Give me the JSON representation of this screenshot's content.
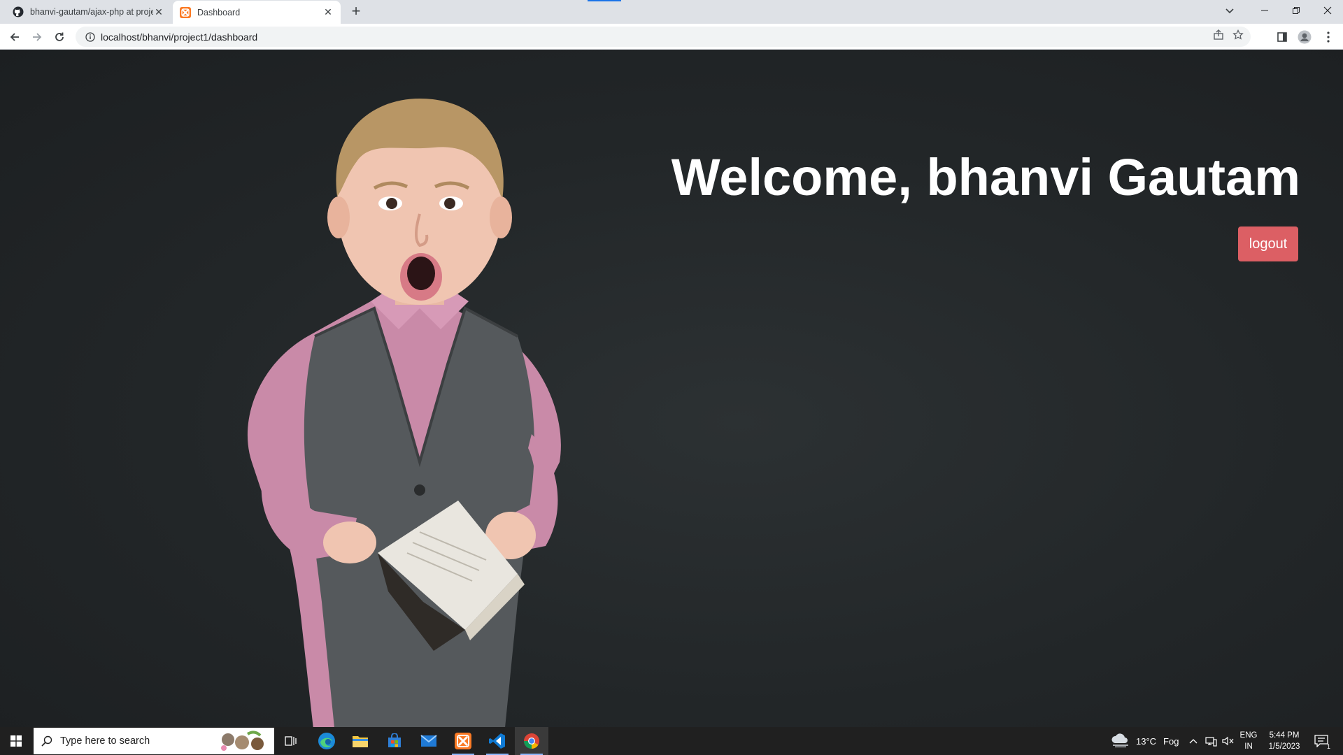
{
  "browser": {
    "tabs": [
      {
        "title": "bhanvi-gautam/ajax-php at proje",
        "icon": "github-icon",
        "active": false
      },
      {
        "title": "Dashboard",
        "icon": "xampp-icon",
        "active": true
      }
    ],
    "address": "localhost/bhanvi/project1/dashboard"
  },
  "page": {
    "welcome": "Welcome, bhanvi Gautam",
    "logout_label": "logout"
  },
  "colors": {
    "background": "#222628",
    "logout": "#dc5f64",
    "heading": "#ffffff"
  },
  "taskbar": {
    "search_placeholder": "Type here to search",
    "apps": [
      "task-view-icon",
      "edge-icon",
      "file-explorer-icon",
      "store-icon",
      "mail-icon",
      "xampp-icon",
      "vscode-icon",
      "chrome-icon"
    ],
    "weather_temp": "13°C",
    "weather_desc": "Fog",
    "lang_line1": "ENG",
    "lang_line2": "IN",
    "time": "5:44 PM",
    "date": "1/5/2023",
    "notification_count": "1"
  }
}
